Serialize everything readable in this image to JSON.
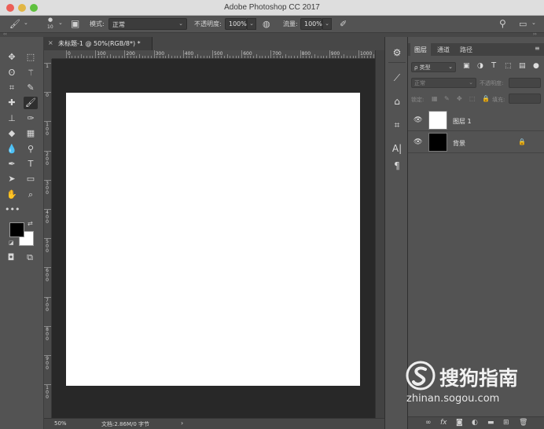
{
  "window": {
    "title": "Adobe Photoshop CC 2017",
    "traffic_colors": {
      "close": "#ec5f57",
      "minimize": "#e1b644",
      "zoom": "#5fc13e"
    }
  },
  "options_bar": {
    "brush_size": "10",
    "mode_label": "模式:",
    "mode_value": "正常",
    "opacity_label": "不透明度:",
    "opacity_value": "100%",
    "flow_label": "流量:",
    "flow_value": "100%"
  },
  "document": {
    "tab_title": "未标题-1 @ 50%(RGB/8*) *",
    "zoom": "50%",
    "doc_info": "文档:2.86M/0 字节",
    "status_arrow": "›",
    "ruler_top_labels": [
      "0",
      "100",
      "200",
      "300",
      "400",
      "500",
      "600",
      "700",
      "800",
      "900",
      "1000"
    ],
    "ruler_left_labels": [
      "1",
      "0",
      "1\n0\n0",
      "2\n0\n0",
      "3\n0\n0",
      "4\n0\n0",
      "5\n0\n0",
      "6\n0\n0",
      "7\n0\n0",
      "8\n0\n0",
      "9\n0\n0",
      "1\n0\n0"
    ]
  },
  "layers_panel": {
    "tabs": [
      "图层",
      "通道",
      "路径"
    ],
    "filter_kind": "ρ 类型",
    "blend_mode": "正常",
    "opacity_label": "不透明度:",
    "lock_label": "锁定:",
    "fill_label": "填充:",
    "layers": [
      {
        "name": "图层 1",
        "thumb_color": "#ffffff",
        "locked": false
      },
      {
        "name": "背景",
        "thumb_color": "#000000",
        "locked": true
      }
    ],
    "bottom_icons": [
      "link-icon",
      "fx-icon",
      "mask-icon",
      "adjustment-icon",
      "folder-icon",
      "new-layer-icon",
      "trash-icon"
    ]
  },
  "watermark": {
    "brand": "搜狗指南",
    "url": "zhinan.sogou.com"
  },
  "colors": {
    "foreground": "#000000",
    "background": "#ffffff"
  }
}
